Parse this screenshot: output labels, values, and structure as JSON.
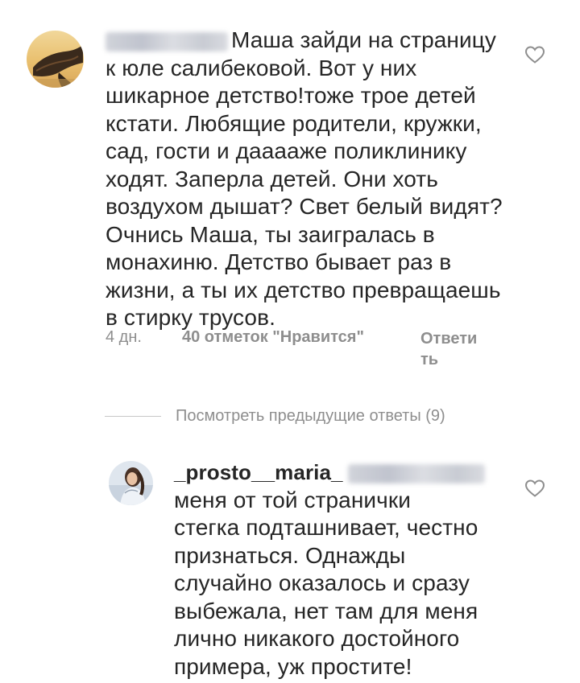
{
  "comments": [
    {
      "username_blurred": true,
      "text_line_first": "Маша зайди на страницу",
      "text_lines": [
        "к юле салибековой. Вот у них",
        "шикарное детство!тоже трое детей",
        "кстати. Любящие родители, кружки,",
        "сад, гости и дааааже поликлинику",
        "ходят. Заперла детей. Они хоть",
        "воздухом дышат? Свет белый видят?",
        "Очнись Маша, ты заигралась в",
        "монахиню. Детство бывает раз в",
        "жизни, а ты их детство превращаешь",
        "в стирку трусов."
      ],
      "time": "4 дн.",
      "likes": "40 отметок \"Нравится\"",
      "reply": "Ответить"
    }
  ],
  "view_replies": "Посмотреть предыдущие ответы (9)",
  "reply_comment": {
    "username": "_prosto__maria_",
    "mention_blurred": true,
    "text_lines": [
      "меня от той странички",
      "стегка подташнивает, честно",
      "признаться. Однажды",
      "случайно оказалось и сразу",
      "выбежала, нет там для меня",
      "лично никакого достойного",
      "примера, уж простите!"
    ]
  },
  "icons": {
    "like": "heart-outline-icon",
    "avatar1": "avatar-hair-photo",
    "avatar2": "avatar-woman-photo"
  },
  "colors": {
    "text": "#262626",
    "secondary": "#8e8e8e",
    "divider": "#c7c7c7"
  }
}
